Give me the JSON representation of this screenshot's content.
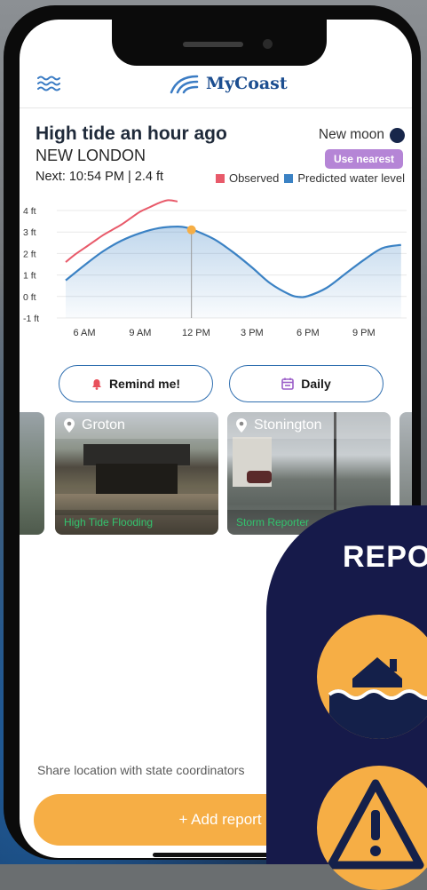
{
  "app": {
    "name": "MyCoast"
  },
  "tide": {
    "status": "High tide an hour ago",
    "station": "NEW LONDON",
    "moon_phase": "New moon",
    "use_nearest_label": "Use nearest",
    "next": "Next: 10:54 PM | 2.4 ft"
  },
  "legend": {
    "observed": "Observed",
    "predicted": "Predicted water level"
  },
  "colors": {
    "observed": "#e85a6a",
    "predicted": "#3b82c4",
    "accent": "#f6ae45",
    "badge": "#b585d6",
    "brand": "#1c4e90"
  },
  "chart_data": {
    "type": "line",
    "y_ticks": [
      "4 ft",
      "3 ft",
      "2 ft",
      "1 ft",
      "0 ft",
      "-1 ft"
    ],
    "y_values": [
      4,
      3,
      2,
      1,
      0,
      -1
    ],
    "x_ticks": [
      "6 AM",
      "9 AM",
      "12 PM",
      "3 PM",
      "6 PM",
      "9 PM"
    ],
    "x_hours": [
      6,
      9,
      12,
      15,
      18,
      21
    ],
    "ylim": [
      -1,
      4
    ],
    "xlim": [
      5,
      23.2
    ],
    "series": [
      {
        "name": "Observed",
        "x": [
          5.0,
          5.5,
          6.0,
          6.5,
          7.0,
          7.5,
          8.0,
          8.5,
          9.0,
          9.5,
          10.0,
          10.5,
          11.0
        ],
        "y": [
          1.6,
          1.95,
          2.25,
          2.55,
          2.85,
          3.1,
          3.35,
          3.65,
          3.95,
          4.15,
          4.35,
          4.48,
          4.42
        ]
      },
      {
        "name": "Predicted water level",
        "x": [
          5.0,
          6.0,
          7.0,
          8.0,
          9.0,
          10.0,
          11.0,
          11.5,
          12.0,
          13.0,
          14.0,
          15.0,
          16.0,
          17.0,
          17.5,
          18.0,
          19.0,
          20.0,
          21.0,
          22.0,
          23.0
        ],
        "y": [
          0.75,
          1.45,
          2.1,
          2.6,
          2.95,
          3.18,
          3.25,
          3.2,
          3.05,
          2.65,
          2.05,
          1.35,
          0.6,
          0.1,
          -0.02,
          0.02,
          0.4,
          1.05,
          1.7,
          2.25,
          2.4
        ]
      }
    ],
    "marker": {
      "x": 11.75,
      "y": 3.1
    }
  },
  "actions": {
    "remind": "Remind me!",
    "daily": "Daily"
  },
  "reports": [
    {
      "location": "Groton",
      "category": "High Tide Flooding"
    },
    {
      "location": "Stonington",
      "category": "Storm Reporter"
    }
  ],
  "share_text": "Share location with state coordinators",
  "add_report": "+ Add report",
  "overlay_title": "REPO"
}
